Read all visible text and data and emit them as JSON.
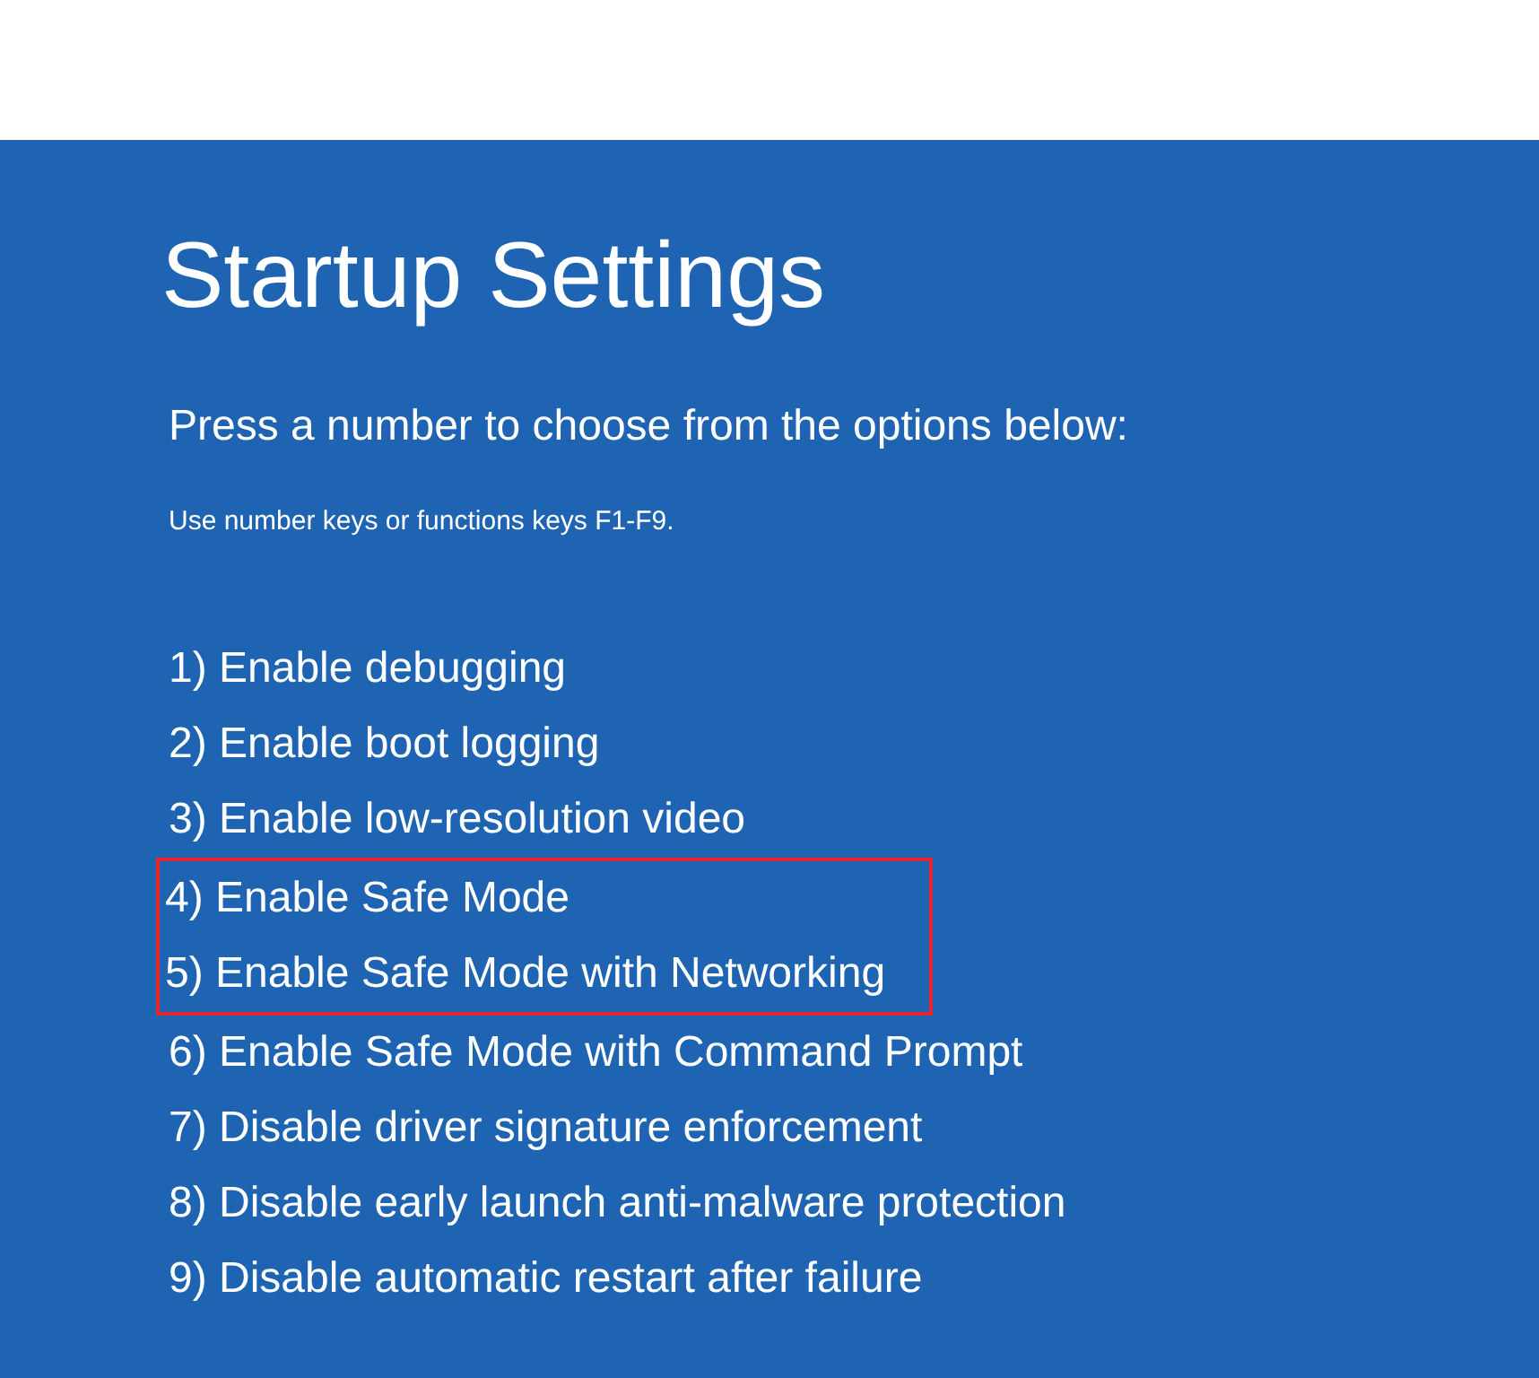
{
  "title": "Startup Settings",
  "prompt": "Press a number to choose from the options below:",
  "hint": "Use number keys or functions keys F1-F9.",
  "options": [
    {
      "label": "1) Enable debugging",
      "highlighted": false
    },
    {
      "label": "2) Enable boot logging",
      "highlighted": false
    },
    {
      "label": "3) Enable low-resolution video",
      "highlighted": false
    },
    {
      "label": "4) Enable Safe Mode",
      "highlighted": true
    },
    {
      "label": "5) Enable Safe Mode with Networking",
      "highlighted": true
    },
    {
      "label": "6) Enable Safe Mode with Command Prompt",
      "highlighted": false
    },
    {
      "label": "7) Disable driver signature enforcement",
      "highlighted": false
    },
    {
      "label": "8) Disable early launch anti-malware protection",
      "highlighted": false
    },
    {
      "label": "9) Disable automatic restart after failure",
      "highlighted": false
    }
  ]
}
